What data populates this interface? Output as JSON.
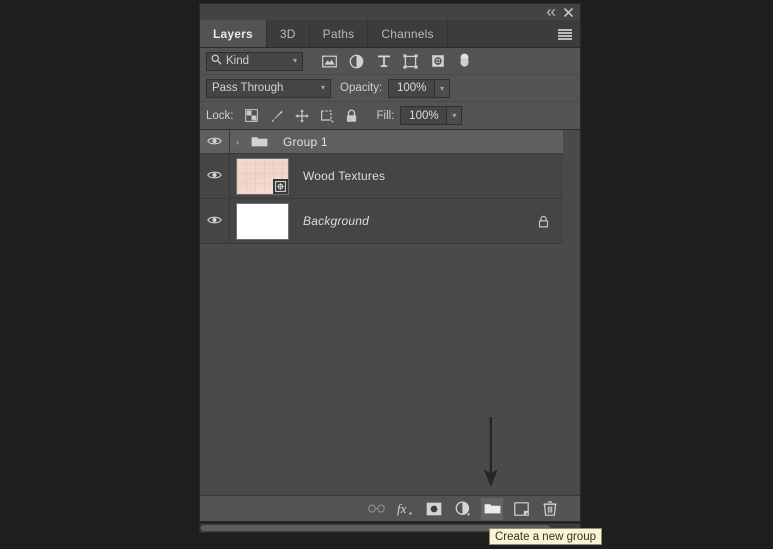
{
  "window": {
    "collapse_icon": "collapse-double-chevron-icon",
    "close_icon": "close-icon"
  },
  "tabs": [
    {
      "label": "Layers",
      "active": true
    },
    {
      "label": "3D",
      "active": false
    },
    {
      "label": "Paths",
      "active": false
    },
    {
      "label": "Channels",
      "active": false
    }
  ],
  "panel_menu_label": "panel-menu",
  "filter": {
    "kind_label": "Kind",
    "search_icon": "search-icon",
    "caret": "▾",
    "icons": [
      {
        "name": "filter-pixel-layers-icon"
      },
      {
        "name": "filter-adjustment-layers-icon"
      },
      {
        "name": "filter-type-layers-icon",
        "glyph": "T"
      },
      {
        "name": "filter-shape-layers-icon"
      },
      {
        "name": "filter-smart-object-layers-icon"
      },
      {
        "name": "filter-toggle-switch-icon"
      }
    ]
  },
  "blend": {
    "mode": "Pass Through",
    "opacity_label": "Opacity:",
    "opacity_value": "100%",
    "caret": "▾"
  },
  "lock": {
    "label": "Lock:",
    "fill_label": "Fill:",
    "fill_value": "100%",
    "caret": "▾",
    "icons": [
      {
        "name": "lock-transparent-pixels-icon"
      },
      {
        "name": "lock-image-pixels-icon"
      },
      {
        "name": "lock-position-icon"
      },
      {
        "name": "lock-artboard-nesting-icon"
      },
      {
        "name": "lock-all-icon"
      }
    ]
  },
  "layers": [
    {
      "type": "group",
      "name": "Group 1",
      "selected": true,
      "visible": true,
      "disclosure": "›",
      "eye_icon": "eye-icon",
      "folder_icon": "folder-icon"
    },
    {
      "type": "layer",
      "name": "Wood Textures",
      "selected": false,
      "visible": true,
      "thumb_class": "wood",
      "smart_object_badge": true,
      "eye_icon": "eye-icon",
      "italic": false,
      "locked": false
    },
    {
      "type": "layer",
      "name": "Background",
      "selected": false,
      "visible": true,
      "thumb_class": "white",
      "smart_object_badge": false,
      "eye_icon": "eye-icon",
      "italic": true,
      "locked": true
    }
  ],
  "bottom_toolbar": [
    {
      "name": "link-layers-button",
      "dim": true,
      "hovered": false
    },
    {
      "name": "add-layer-style-button",
      "dim": false,
      "hovered": false,
      "glyph": "fx"
    },
    {
      "name": "add-layer-mask-button",
      "dim": false,
      "hovered": false
    },
    {
      "name": "new-adjustment-layer-button",
      "dim": false,
      "hovered": false
    },
    {
      "name": "create-new-group-button",
      "dim": false,
      "hovered": true
    },
    {
      "name": "create-new-layer-button",
      "dim": false,
      "hovered": false
    },
    {
      "name": "delete-layer-button",
      "dim": false,
      "hovered": false
    }
  ],
  "tooltip": {
    "text": "Create a new group"
  },
  "colors": {
    "panel_bg": "#535353",
    "list_bg": "#4a4a4a",
    "row_bg": "#454545",
    "row_selected": "#5f5f5f",
    "tab_active_bg": "#535353",
    "tabstrip_bg": "#3c3c3c",
    "tooltip_bg": "#f7f4d8",
    "tooltip_text": "#3a2f22",
    "desktop_bg": "#1e1e1e",
    "text": "#dedede"
  }
}
